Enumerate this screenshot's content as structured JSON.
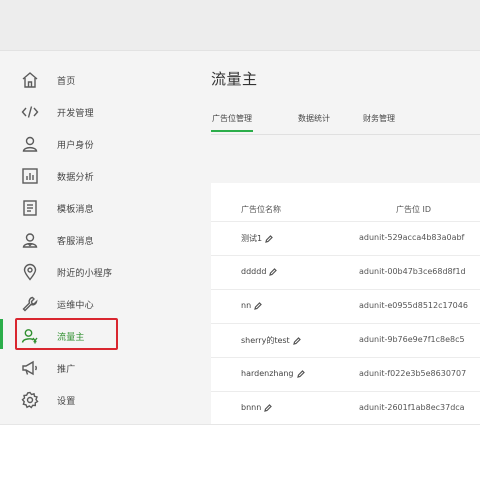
{
  "sidebar": {
    "items": [
      {
        "label": "首页",
        "icon": "home-icon"
      },
      {
        "label": "开发管理",
        "icon": "code-icon"
      },
      {
        "label": "用户身份",
        "icon": "user-icon"
      },
      {
        "label": "数据分析",
        "icon": "bar-chart-icon"
      },
      {
        "label": "模板消息",
        "icon": "document-icon"
      },
      {
        "label": "客服消息",
        "icon": "customer-service-icon"
      },
      {
        "label": "附近的小程序",
        "icon": "location-pin-icon"
      },
      {
        "label": "运维中心",
        "icon": "wrench-icon"
      },
      {
        "label": "流量主",
        "icon": "user-money-icon",
        "active": true
      },
      {
        "label": "推广",
        "icon": "megaphone-icon"
      },
      {
        "label": "设置",
        "icon": "gear-icon"
      }
    ]
  },
  "main": {
    "title": "流量主",
    "tabs": [
      {
        "label": "广告位管理",
        "active": true
      },
      {
        "label": "数据统计"
      },
      {
        "label": "财务管理"
      }
    ],
    "table": {
      "headers": [
        "广告位名称",
        "广告位 ID"
      ],
      "rows": [
        {
          "name": "测试1",
          "unit_id": "adunit-529acca4b83a0abf"
        },
        {
          "name": "ddddd",
          "unit_id": "adunit-00b47b3ce68d8f1d"
        },
        {
          "name": "nn",
          "unit_id": "adunit-e0955d8512c17046"
        },
        {
          "name": "sherry的test",
          "unit_id": "adunit-9b76e9e7f1c8e8c5"
        },
        {
          "name": "hardenzhang",
          "unit_id": "adunit-f022e3b5e8630707"
        },
        {
          "name": "bnnn",
          "unit_id": "adunit-2601f1ab8ec37dca"
        }
      ]
    }
  },
  "colors": {
    "accent_green": "#2bad4a",
    "highlight_red": "#d9262f"
  }
}
